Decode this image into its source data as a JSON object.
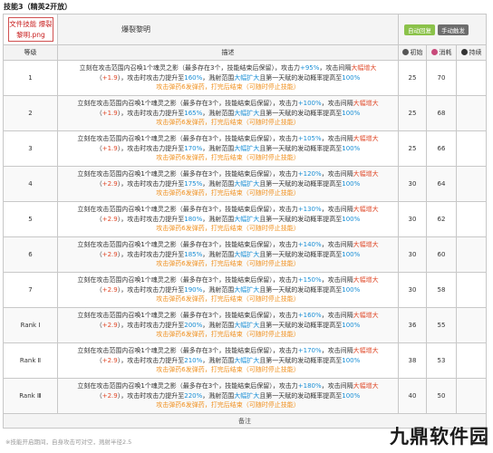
{
  "section_title": "技能3（精英2开放）",
  "skill": {
    "icon_text": "文件技能 爆裂黎明.png",
    "name": "爆裂黎明",
    "tags": [
      "自动回复",
      "手动触发"
    ]
  },
  "columns": {
    "level": "等级",
    "desc": "描述",
    "initial": "初始",
    "cost": "消耗",
    "duration": "持续"
  },
  "rows": [
    {
      "level": "1",
      "atk": "+95%",
      "interval": "+1.9",
      "atk_prison": "160%",
      "initial": "25",
      "cost": "70"
    },
    {
      "level": "2",
      "atk": "+100%",
      "interval": "+1.9",
      "atk_prison": "165%",
      "initial": "25",
      "cost": "68"
    },
    {
      "level": "3",
      "atk": "+105%",
      "interval": "+1.9",
      "atk_prison": "170%",
      "initial": "25",
      "cost": "66"
    },
    {
      "level": "4",
      "atk": "+120%",
      "interval": "+2.9",
      "atk_prison": "175%",
      "initial": "30",
      "cost": "64"
    },
    {
      "level": "5",
      "atk": "+130%",
      "interval": "+2.9",
      "atk_prison": "180%",
      "initial": "30",
      "cost": "62"
    },
    {
      "level": "6",
      "atk": "+140%",
      "interval": "+2.9",
      "atk_prison": "185%",
      "initial": "30",
      "cost": "60"
    },
    {
      "level": "7",
      "atk": "+150%",
      "interval": "+2.9",
      "atk_prison": "190%",
      "initial": "30",
      "cost": "58"
    },
    {
      "level": "Rank Ⅰ",
      "atk": "+160%",
      "interval": "+2.9",
      "atk_prison": "200%",
      "initial": "36",
      "cost": "55"
    },
    {
      "level": "Rank Ⅱ",
      "atk": "+170%",
      "interval": "+2.9",
      "atk_prison": "210%",
      "initial": "38",
      "cost": "53"
    },
    {
      "level": "Rank Ⅲ",
      "atk": "+180%",
      "interval": "+2.9",
      "atk_prison": "220%",
      "initial": "40",
      "cost": "50"
    }
  ],
  "desc_text": {
    "l1_a": "立刻在攻击范围内召唤1个魂灵之影（最多存在3个，技能结束后保留），攻击力",
    "l1_b": "，攻击间隔",
    "l1_c": "大幅增大",
    "l2_a": "（",
    "l2_b": "），攻击时攻击力提升至",
    "l2_c": "，溅射范围",
    "l2_d": "大幅扩大",
    "l2_e": "且第一天赋的发动概率提高至",
    "l2_f": "100%",
    "l3_a": "攻击弹药6发弹药",
    "l3_b": "，打完后结束",
    "l3_c": "（可随时停止技能）"
  },
  "remark_label": "备注",
  "footnote": "※技能开启期间，自身攻击可对空，溅射半径2.5",
  "watermark": "九鼎软件园"
}
